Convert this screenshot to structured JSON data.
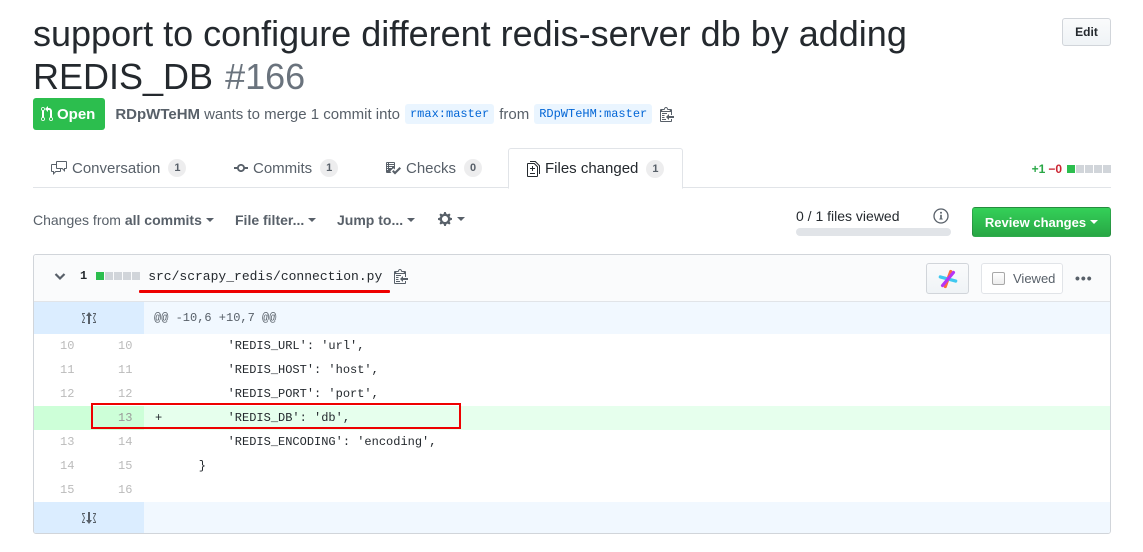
{
  "pr": {
    "title": "support to configure different redis-server db by adding REDIS_DB",
    "number": "#166",
    "edit_label": "Edit",
    "state_label": "Open",
    "state_color": "#2cbe4e",
    "author": "RDpWTeHM",
    "merge_text": "wants to merge 1 commit into",
    "base_branch": "rmax:master",
    "from_text": "from",
    "head_branch": "RDpWTeHM:master"
  },
  "tabs": [
    {
      "label": "Conversation",
      "count": "1",
      "icon": "comment-discussion-icon"
    },
    {
      "label": "Commits",
      "count": "1",
      "icon": "git-commit-icon"
    },
    {
      "label": "Checks",
      "count": "0",
      "icon": "checklist-icon"
    },
    {
      "label": "Files changed",
      "count": "1",
      "icon": "file-diff-icon",
      "active": true
    }
  ],
  "diffstat": {
    "additions": "+1",
    "deletions": "−0",
    "blocks": [
      "added",
      "neutral",
      "neutral",
      "neutral",
      "neutral"
    ]
  },
  "toolbar": {
    "changes_prefix": "Changes from",
    "changes_value": "all commits",
    "file_filter": "File filter...",
    "jump_to": "Jump to...",
    "files_viewed": "0 / 1 files viewed",
    "files_viewed_progress": 0,
    "review_label": "Review changes"
  },
  "file": {
    "count": "1",
    "path": "src/scrapy_redis/connection.py",
    "viewed_label": "Viewed",
    "viewed_checked": false,
    "more": "•••"
  },
  "diff": {
    "hunk": "@@ -10,6 +10,7 @@",
    "lines": [
      {
        "old": "10",
        "new": "10",
        "type": "context",
        "marker": " ",
        "code": "        'REDIS_URL': 'url',"
      },
      {
        "old": "11",
        "new": "11",
        "type": "context",
        "marker": " ",
        "code": "        'REDIS_HOST': 'host',"
      },
      {
        "old": "12",
        "new": "12",
        "type": "context",
        "marker": " ",
        "code": "        'REDIS_PORT': 'port',"
      },
      {
        "old": "",
        "new": "13",
        "type": "add",
        "marker": "+",
        "code": "        'REDIS_DB': 'db',"
      },
      {
        "old": "13",
        "new": "14",
        "type": "context",
        "marker": " ",
        "code": "        'REDIS_ENCODING': 'encoding',"
      },
      {
        "old": "14",
        "new": "15",
        "type": "context",
        "marker": " ",
        "code": "    }"
      },
      {
        "old": "15",
        "new": "16",
        "type": "context",
        "marker": " ",
        "code": ""
      }
    ]
  }
}
